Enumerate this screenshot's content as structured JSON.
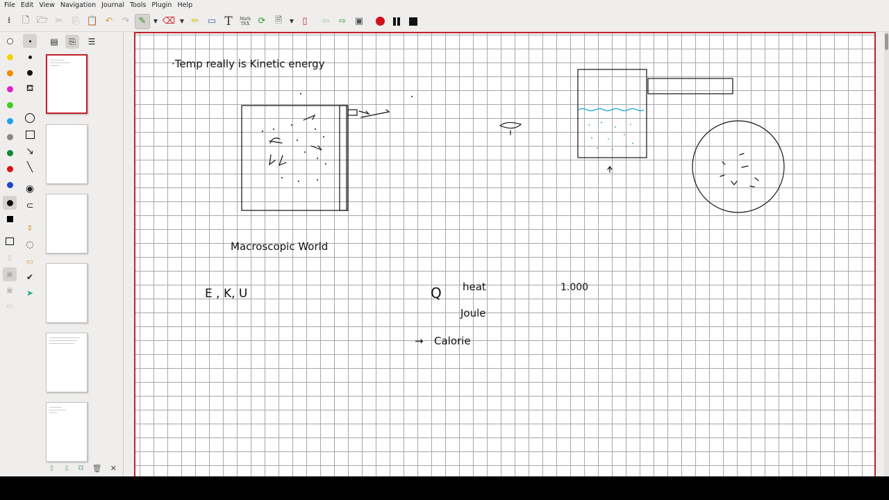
{
  "menubar": {
    "items": [
      "File",
      "Edit",
      "View",
      "Navigation",
      "Journal",
      "Tools",
      "Plugin",
      "Help"
    ]
  },
  "toolbar": {
    "mathtex_label": "Math\nTEX",
    "text_tool_label": "T"
  },
  "colors": {
    "page_border": "#c0202a",
    "grid": "#a7a7a7",
    "ink": "#111111",
    "water": "#22a8d8",
    "record": "#d0101c",
    "palette": [
      "#ffffff",
      "#f2d500",
      "#f08c00",
      "#e020c8",
      "#44cc22",
      "#20a0e8",
      "#888888",
      "#118833",
      "#dd1111",
      "#2244cc",
      "#111111",
      "#000000"
    ]
  },
  "notes": {
    "line1": "·Temp   really  is     Kinetic  energy",
    "macro": "Macroscopic  World",
    "eku": "E   ,   K,   U",
    "q": "Q",
    "heat": "heat",
    "number": "1.000",
    "joule": "Joule",
    "arrow": "→",
    "calorie": "Calorie"
  },
  "thumbnails": {
    "count": 6,
    "current_index": 0
  }
}
